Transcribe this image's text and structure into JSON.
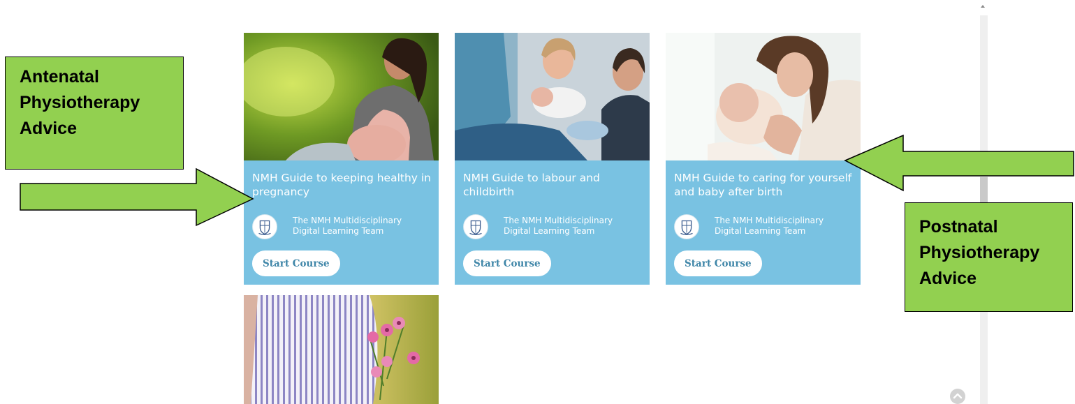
{
  "colors": {
    "card_background": "#79c2e2",
    "button_text": "#3f86a8",
    "annotation_fill": "#92d050",
    "annotation_border": "#000000"
  },
  "courses": [
    {
      "title": "NMH Guide to keeping healthy in pregnancy",
      "author": "The NMH Multidisciplinary\nDigital Learning Team",
      "button_label": "Start Course"
    },
    {
      "title": "NMH Guide to labour and childbirth",
      "author": "The NMH Multidisciplinary\nDigital Learning Team",
      "button_label": "Start Course"
    },
    {
      "title": "NMH Guide to caring for yourself and baby after birth",
      "author": "The NMH Multidisciplinary\nDigital Learning Team",
      "button_label": "Start Course"
    }
  ],
  "annotations": {
    "antenatal": "Antenatal\nPhysiotherapy\nAdvice",
    "postnatal": "Postnatal\nPhysiotherapy\nAdvice"
  },
  "icons": {
    "author_logo": "crest-icon",
    "scroll_top": "chevron-up-icon"
  }
}
